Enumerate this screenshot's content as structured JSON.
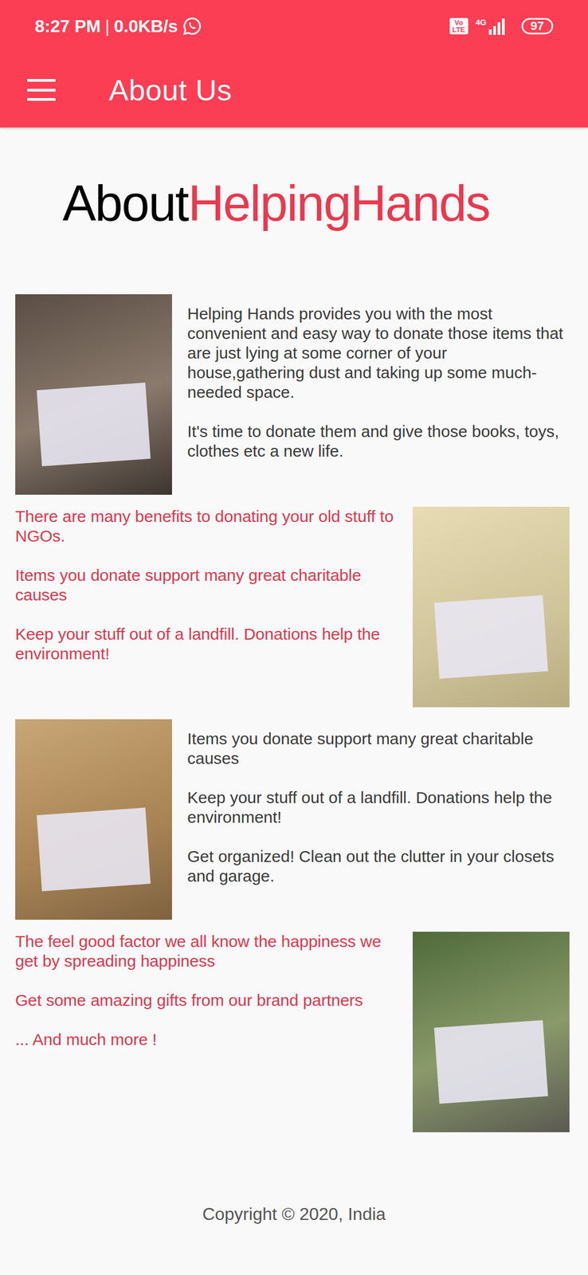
{
  "status_bar": {
    "time": "8:27 PM",
    "separator": "|",
    "speed": "0.0KB/s",
    "volte": "Vo LTE",
    "network": "4G",
    "battery": "97"
  },
  "app_bar": {
    "title": "About Us"
  },
  "heading": {
    "part1": "About",
    "part2": "HelpingHands"
  },
  "sections": [
    {
      "kind": "image-left",
      "paragraphs": [
        "Helping Hands provides you with the most convenient and easy way to donate those items that are just lying at some corner of your house,gathering dust and taking up some much-needed space.",
        "It's time to donate them and give those books, toys, clothes etc a new life."
      ]
    },
    {
      "kind": "image-right",
      "paragraphs": [
        "There are many benefits to donating your old stuff to NGOs.",
        "Items you donate support many great charitable causes",
        "Keep your stuff out of a landfill. Donations help the environment!"
      ]
    },
    {
      "kind": "image-left",
      "paragraphs": [
        "Items you donate support many great charitable causes",
        "Keep your stuff out of a landfill. Donations help the environment!",
        "Get organized! Clean out the clutter in your closets and garage."
      ]
    },
    {
      "kind": "image-right",
      "paragraphs": [
        "The feel good factor we all know the happiness we get by spreading happiness",
        "Get some amazing gifts from our brand partners",
        "... And much more !"
      ]
    }
  ],
  "footer": "Copyright © 2020, India"
}
